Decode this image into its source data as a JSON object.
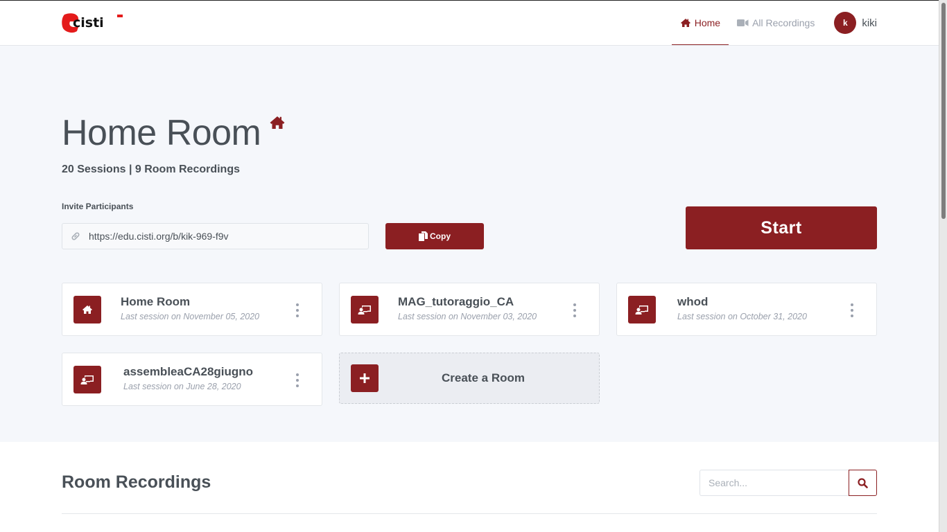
{
  "header": {
    "logo_text": "cisti",
    "nav": [
      {
        "label": "Home",
        "icon": "home-icon",
        "active": true
      },
      {
        "label": "All Recordings",
        "icon": "video-camera-icon",
        "active": false
      }
    ],
    "user": {
      "initial": "k",
      "name": "kiki"
    }
  },
  "room": {
    "title": "Home Room",
    "stats": "20 Sessions | 9 Room Recordings",
    "invite_label": "Invite Participants",
    "invite_url": "https://edu.cisti.org/b/kik-969-f9v",
    "copy_label": "Copy",
    "start_label": "Start"
  },
  "rooms": [
    {
      "name": "Home Room",
      "last_session": "Last session on November 05, 2020",
      "icon": "home-icon"
    },
    {
      "name": "MAG_tutoraggio_CA",
      "last_session": "Last session on November 03, 2020",
      "icon": "chalkboard-teacher-icon"
    },
    {
      "name": "whod",
      "last_session": "Last session on October 31, 2020",
      "icon": "chalkboard-teacher-icon"
    },
    {
      "name": "assembleaCA28giugno",
      "last_session": "Last session on June 28, 2020",
      "icon": "chalkboard-teacher-icon"
    }
  ],
  "create_room": {
    "label": "Create a Room"
  },
  "recordings": {
    "title": "Room Recordings",
    "search_placeholder": "Search..."
  },
  "colors": {
    "brand": "#8b1f22",
    "background": "#f5f7fb",
    "text": "#495057",
    "muted": "#9aa0ac"
  }
}
